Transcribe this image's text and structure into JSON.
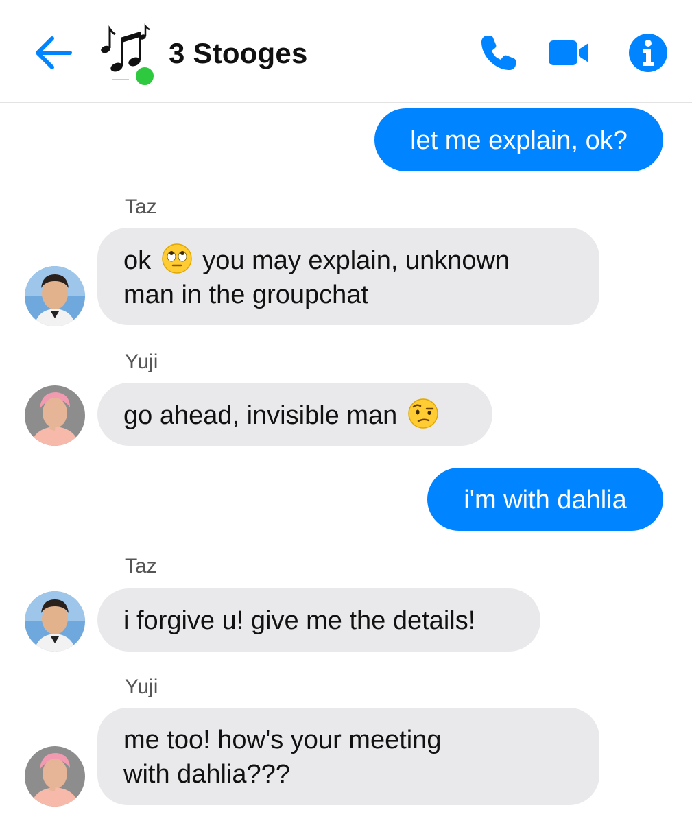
{
  "header": {
    "title": "3 Stooges",
    "accent_color": "#0084ff",
    "online_color": "#2ec93f",
    "icons": [
      "back-arrow-icon",
      "music-notes-icon",
      "phone-icon",
      "video-camera-icon",
      "info-icon"
    ]
  },
  "messages": [
    {
      "type": "outgoing",
      "text": "let me explain, ok?"
    },
    {
      "type": "incoming",
      "sender": "Taz",
      "line1": "ok",
      "emoji": "eye-roll-emoji",
      "line1_rest": "you may explain, unknown",
      "line2": "man in the groupchat"
    },
    {
      "type": "incoming",
      "sender": "Yuji",
      "text": "go ahead, invisible man",
      "emoji": "raised-eyebrow-emoji"
    },
    {
      "type": "outgoing",
      "text": "i'm with dahlia"
    },
    {
      "type": "incoming",
      "sender": "Taz",
      "text": "i forgive u! give me the details!"
    },
    {
      "type": "incoming",
      "sender": "Yuji",
      "line1": "me too! how's your meeting",
      "line2": "with dahlia???"
    }
  ],
  "colors": {
    "outgoing_bubble": "#0084ff",
    "incoming_bubble": "#e9e9eb"
  }
}
